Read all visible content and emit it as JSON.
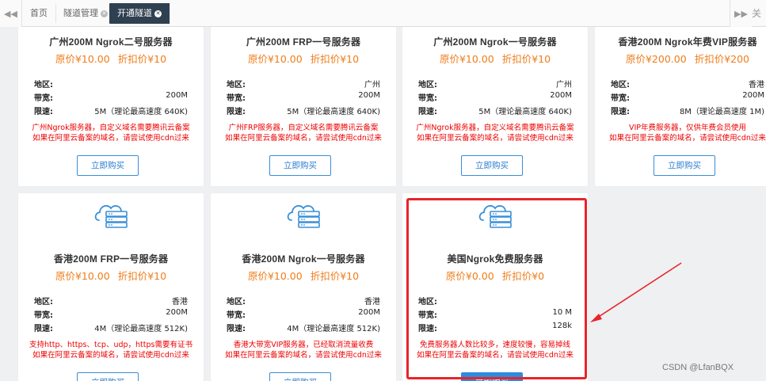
{
  "tabs": {
    "home": "首页",
    "tunnels": "隧道管理",
    "open": "开通隧道",
    "overflow": "关"
  },
  "labels": {
    "region": "地区:",
    "bandwidth": "带宽:",
    "speed": "限速:",
    "buy": "立即购买"
  },
  "cards": [
    {
      "title": "广州200M Ngrok二号服务器",
      "orig": "原价¥10.00",
      "discount": "折扣价¥10",
      "region": "",
      "bandwidth": "200M",
      "speed": "5M（理论最高速度 640K)",
      "note1": "广州Ngrok服务器，自定义域名需要腾讯云备案",
      "note2": "如果在阿里云备案的域名，请尝试使用cdn过来"
    },
    {
      "title": "广州200M FRP一号服务器",
      "orig": "原价¥10.00",
      "discount": "折扣价¥10",
      "region": "广州",
      "bandwidth": "200M",
      "speed": "5M（理论最高速度 640K)",
      "note1": "广州FRP服务器，自定义域名需要腾讯云备案",
      "note2": "如果在阿里云备案的域名，请尝试使用cdn过来"
    },
    {
      "title": "广州200M Ngrok一号服务器",
      "orig": "原价¥10.00",
      "discount": "折扣价¥10",
      "region": "广州",
      "bandwidth": "200M",
      "speed": "5M（理论最高速度 640K)",
      "note1": "广州Ngrok服务器，自定义域名需要腾讯云备案",
      "note2": "如果在阿里云备案的域名，请尝试使用cdn过来"
    },
    {
      "title": "香港200M Ngrok年费VIP服务器",
      "orig": "原价¥200.00",
      "discount": "折扣价¥200",
      "region": "香港",
      "bandwidth": "200M",
      "speed": "8M（理论最高速度 1M)",
      "note1": "VIP年费服务器，仅供年费会员使用",
      "note2": "如果在阿里云备案的域名，请尝试使用cdn过来"
    },
    {
      "title": "香港200M FRP一号服务器",
      "orig": "原价¥10.00",
      "discount": "折扣价¥10",
      "region": "香港",
      "bandwidth": "200M",
      "speed": "4M（理论最高速度 512K)",
      "note1": "支持http、https、tcp、udp，https需要有证书",
      "note2": "如果在阿里云备案的域名，请尝试使用cdn过来"
    },
    {
      "title": "香港200M Ngrok一号服务器",
      "orig": "原价¥10.00",
      "discount": "折扣价¥10",
      "region": "香港",
      "bandwidth": "200M",
      "speed": "4M（理论最高速度 512K)",
      "note1": "香港大带宽VIP服务器，已经取消流量收费",
      "note2": "如果在阿里云备案的域名，请尝试使用cdn过来"
    },
    {
      "title": "美国Ngrok免费服务器",
      "orig": "原价¥0.00",
      "discount": "折扣价¥0",
      "region": "",
      "bandwidth": "10 M",
      "speed": "128k",
      "note1": "免费服务器人数比较多，速度较慢，容易掉线",
      "note2": "如果在阿里云备案的域名，请尝试使用cdn过来"
    }
  ],
  "watermark": "CSDN @LfanBQX",
  "colors": {
    "price": "#ef7d19",
    "note": "#e00000",
    "button": "#2d8ce0",
    "highlight": "#e8242a",
    "active_tab": "#2f4050"
  }
}
